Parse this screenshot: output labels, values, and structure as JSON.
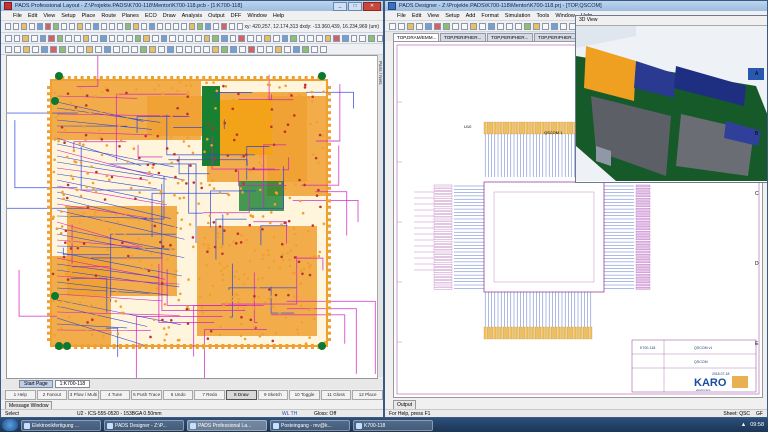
{
  "layout_window": {
    "title": "PADS Professional Layout - Z:\\Projekte.PADS\\K700-118\\Mentor\\K700-118.pcb - [1:K700-118]",
    "menu": [
      "File",
      "Edit",
      "View",
      "Setup",
      "Place",
      "Route",
      "Planes",
      "ECO",
      "Draw",
      "Analysis",
      "Output",
      "DFF",
      "Window",
      "Help"
    ],
    "coords": "xy: 420,257, 12.174,313  dxdy: -13.360,439, 16.234,969 (um)",
    "side_label": "Parts / Nets",
    "sheet_tabs": [
      "Start Page",
      "1:K700-118"
    ],
    "function_keys": [
      "1 Help",
      "2 Fanout",
      "3 Plow / Multi",
      "4 Tune",
      "5 Push Trace",
      "6 Undo",
      "7 Redo",
      "8 Draw",
      "9 Sketch",
      "10 Toggle",
      "11 Gloss",
      "12 Place"
    ],
    "active_key_index": 7,
    "message_window": "Message Window",
    "status": {
      "mode": "Select",
      "part": "U2 - ICS-555-0520 - 153BGA 0.50mm",
      "zoom": "WL TH",
      "gloss": "Gloss: Off"
    }
  },
  "designer_window": {
    "title": "PADS Designer - Z:\\Projekte.PADS\\K700-118\\Mentor\\K700-118.prj - [TOP,QSCOM]",
    "menu": [
      "File",
      "Edit",
      "View",
      "Setup",
      "Add",
      "Format",
      "Simulation",
      "Tools",
      "Window",
      "Help"
    ],
    "tabs": [
      "TOP,DRAM/EMM...",
      "TOP,PERIPHER...",
      "TOP,PERIPHER...",
      "TOP,PERIPHER..."
    ],
    "view3d_title": "3D View",
    "output_tab": "Output",
    "status_left": "For Help, press F1",
    "status_right": "Sheet: QSC",
    "status_right2": "GF",
    "chip_labels": {
      "top": "U10",
      "block": "QSCOM 1",
      "sub": "K700-118"
    },
    "title_block": {
      "project": "K700-118",
      "doc": "QSCOM v1",
      "sheet": "QSCOM",
      "date": "2018-07-18",
      "company": "KARO",
      "company_sub": "electronics"
    },
    "border_rows": [
      "A",
      "B",
      "C",
      "D",
      "E"
    ]
  },
  "taskbar": {
    "items": [
      "Elektronikfertigung ...",
      "PADS Designer - Z:\\P...",
      "PADS Professional La...",
      "Posteingang - mv@k...",
      "K700-118"
    ],
    "time": "09:58"
  },
  "colors": {
    "copper": "#f0a030",
    "trace_blue": "#3048d8",
    "trace_magenta": "#d020c0",
    "board_green": "#188030",
    "fiducial": "#0a7a30"
  }
}
